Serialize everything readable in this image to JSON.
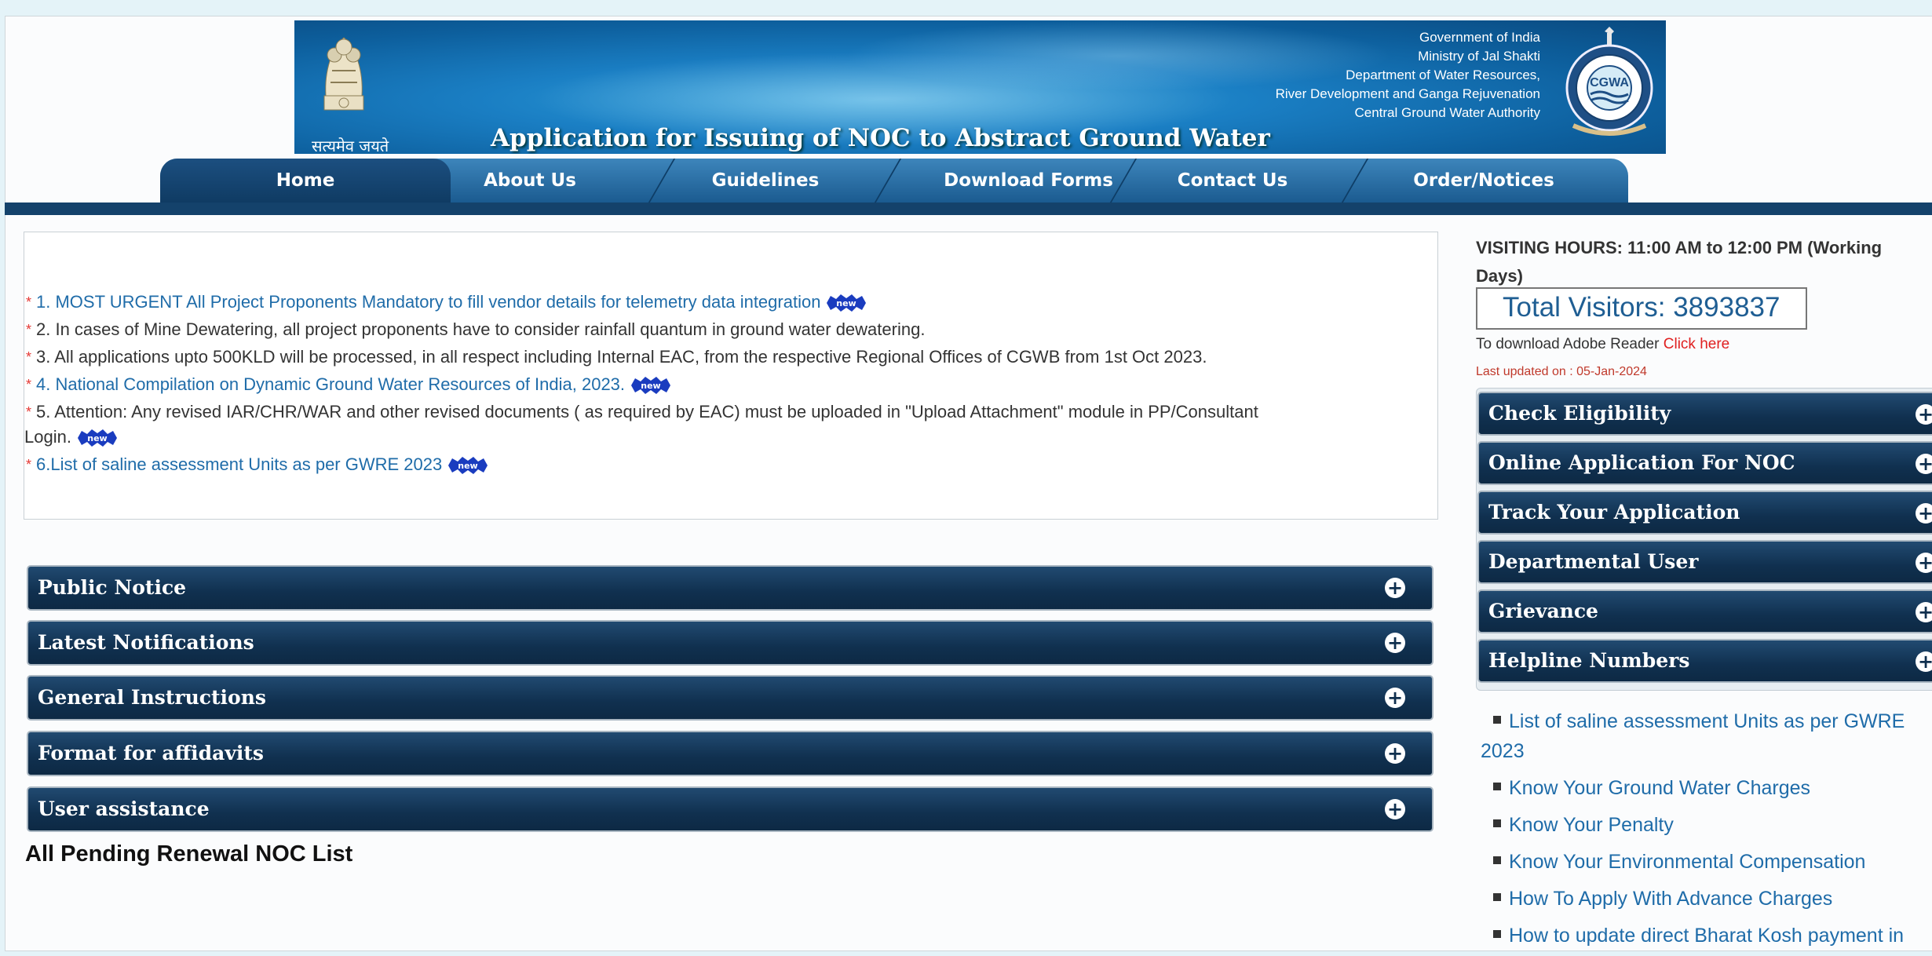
{
  "header": {
    "emblem_caption": "सत्यमेव जयते",
    "title": "Application for Issuing of NOC to Abstract Ground Water",
    "gov_lines": [
      "Government of India",
      "Ministry of Jal Shakti",
      "Department of Water Resources,",
      "River Development and Ganga Rejuvenation",
      "Central Ground Water Authority"
    ],
    "logo_text": "CGWA"
  },
  "nav": {
    "items": [
      "Home",
      "About Us",
      "Guidelines",
      "Download Forms",
      "Contact Us",
      "Order/Notices"
    ]
  },
  "notices": [
    {
      "text": "1. MOST URGENT All Project Proponents Mandatory to fill vendor details for telemetry data integration",
      "is_link": true,
      "is_new": true
    },
    {
      "text": "2. In cases of Mine Dewatering, all project proponents have to consider rainfall quantum in ground water dewatering.",
      "is_link": false,
      "is_new": false
    },
    {
      "text": "3. All applications upto 500KLD will be processed, in all respect including Internal EAC, from the respective Regional Offices of CGWB from 1st Oct 2023.",
      "is_link": false,
      "is_new": false
    },
    {
      "text": "4. National Compilation on Dynamic Ground Water Resources of India, 2023.",
      "is_link": true,
      "is_new": true
    },
    {
      "text": "5. Attention: Any revised IAR/CHR/WAR and other revised documents ( as required by EAC) must be uploaded in \"Upload Attachment\" module in PP/Consultant",
      "continuation": "Login.",
      "is_link": false,
      "is_new": true
    },
    {
      "text": "6.List of saline assessment Units as per GWRE 2023",
      "is_link": true,
      "is_new": true
    }
  ],
  "new_badge": "new",
  "accordions": [
    "Public Notice",
    "Latest Notifications",
    "General Instructions",
    "Format for affidavits",
    "User assistance"
  ],
  "pending_title": "All Pending Renewal NOC List",
  "right": {
    "visiting_hours": "VISITING HOURS: 11:00 AM to 12:00 PM (Working Days)",
    "total_visitors": "Total Visitors: 3893837",
    "adobe_prefix": "To download Adobe Reader",
    "adobe_link": "Click here",
    "last_updated": "Last updated on : 05-Jan-2024",
    "side_accordions": [
      "Check Eligibility",
      "Online Application For NOC",
      "Track Your Application",
      "Departmental User",
      "Grievance",
      "Helpline Numbers"
    ],
    "links": [
      "List of saline assessment Units as per GWRE",
      "2023",
      "Know Your Ground Water Charges",
      "Know Your Penalty",
      "Know Your Environmental Compensation",
      "How To Apply With Advance Charges",
      "How to update direct Bharat Kosh payment in"
    ]
  },
  "colors": {
    "nav_blue": "#1b5b90",
    "accordion_dark": "#10304f",
    "link_blue": "#1f6ca9",
    "accent_red": "#e02020"
  }
}
